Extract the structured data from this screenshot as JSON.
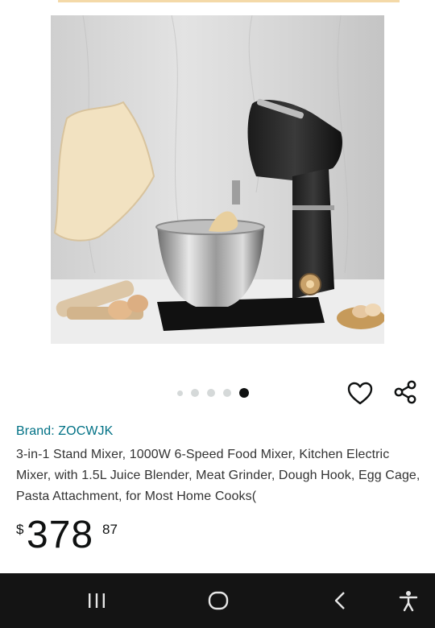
{
  "product": {
    "brand": "Brand: ZOCWJK",
    "title": "3-in-1 Stand Mixer, 1000W 6-Speed Food Mixer, Kitchen Electric Mixer, with 1.5L Juice Blender, Meat Grinder, Dough Hook, Egg Cage, Pasta Attachment, for Most Home Cooks(",
    "price": {
      "symbol": "$",
      "whole": "378",
      "fraction": "87"
    }
  },
  "gallery": {
    "image_count": 5,
    "active_index": 4
  },
  "icons": {
    "wishlist": "heart-icon",
    "share": "share-icon",
    "nav_recents": "recents-icon",
    "nav_home": "home-icon",
    "nav_back": "back-icon",
    "nav_accessibility": "accessibility-icon"
  },
  "colors": {
    "brand_link": "#007185",
    "text": "#0f1111",
    "nav_bar": "#141414"
  }
}
